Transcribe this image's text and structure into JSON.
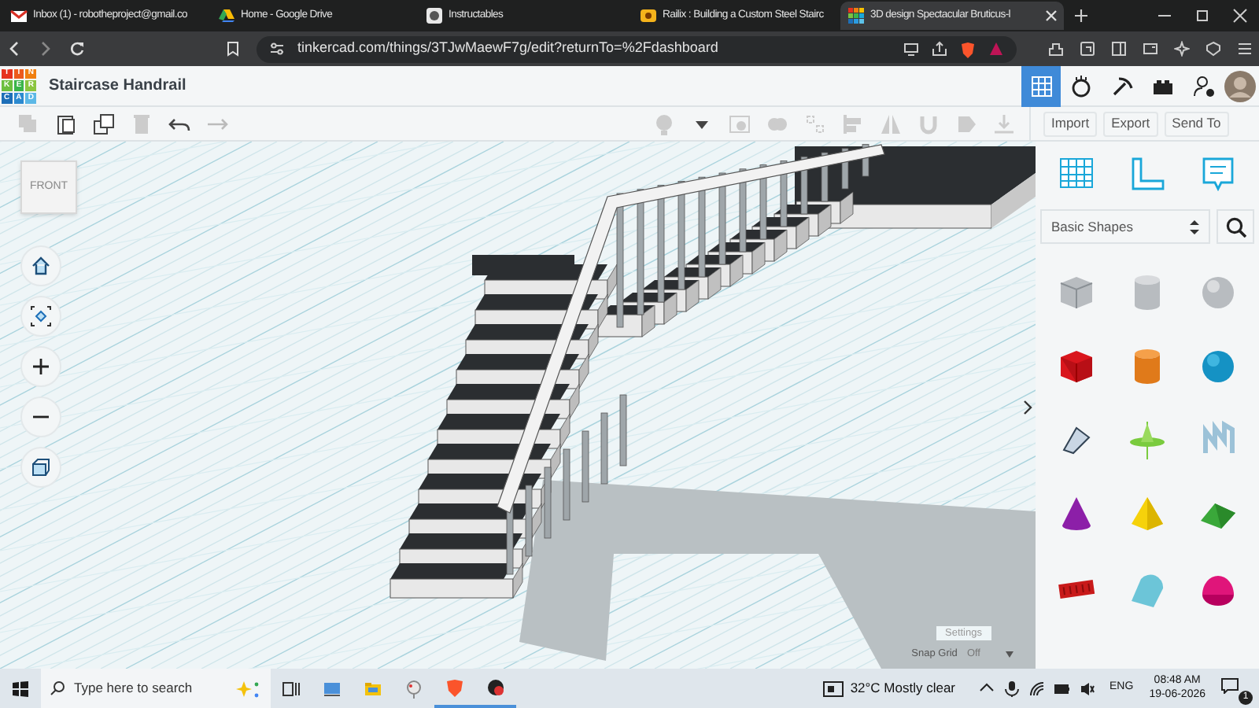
{
  "browser": {
    "tabs": [
      {
        "kind": "mail",
        "title": "Inbox (1) - robotheproject@gmail.co",
        "selected": false
      },
      {
        "kind": "drive",
        "title": "Home - Google Drive",
        "selected": false
      },
      {
        "kind": "instructables",
        "title": "Instructables",
        "selected": false
      },
      {
        "kind": "site",
        "title": "Railix : Building a Custom Steel Stairc",
        "selected": false
      },
      {
        "kind": "tinkercad",
        "title": "3D design Spectacular Bruticus-l",
        "selected": true
      }
    ],
    "address": "tinkercad.com/things/3TJwMaewF7g/edit?returnTo=%2Fdashboard"
  },
  "app": {
    "logo": [
      "T",
      "I",
      "N",
      "K",
      "E",
      "R",
      "C",
      "A",
      "D"
    ],
    "design_title": "Staircase Handrail",
    "toolbar_buttons": [
      "Import",
      "Export",
      "Send To"
    ]
  },
  "view_cube": {
    "label": "FRONT"
  },
  "shape_panel": {
    "category": "Basic Shapes"
  },
  "settings": {
    "label": "Settings",
    "snap_grid_label": "Snap Grid",
    "snap_grid_value": "Off"
  },
  "taskbar": {
    "search_placeholder": "Type here to search",
    "weather": "32°C Mostly clear",
    "language": "ENG",
    "time": "08:48 AM",
    "date": "19-06-2026",
    "notifications": "1"
  }
}
